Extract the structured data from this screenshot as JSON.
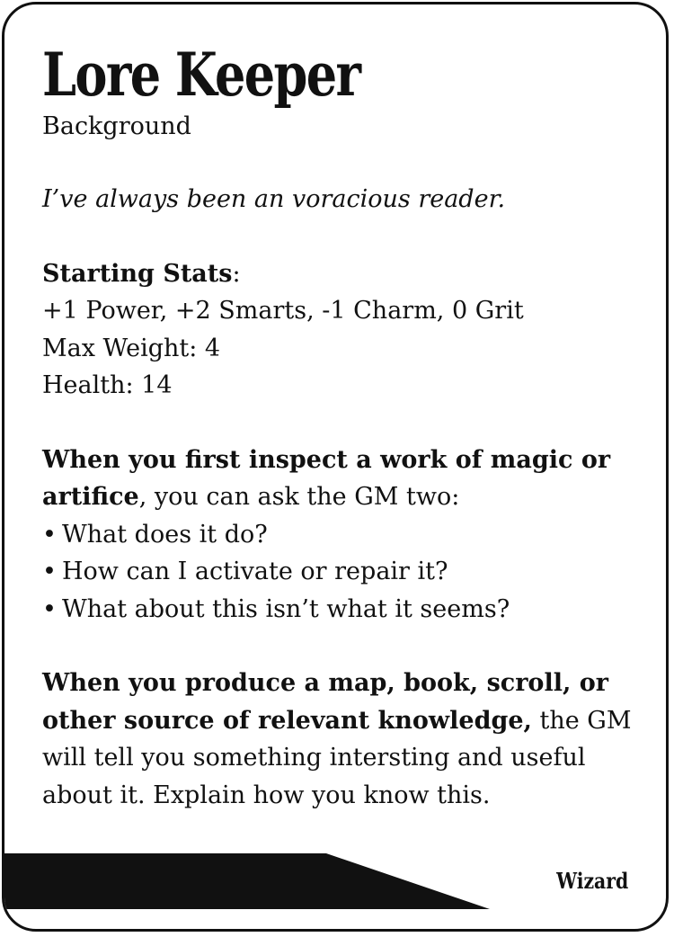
{
  "card": {
    "title": "Lore Keeper",
    "subtitle": "Background",
    "quote": "I’ve always been an voracious reader.",
    "stats": {
      "heading": "Starting Stats",
      "colon": ":",
      "line1": "+1 Power, +2 Smarts, -1 Charm, 0 Grit",
      "line2": "Max Weight: 4",
      "line3": "Health: 14"
    },
    "move1": {
      "bold": "When you first inspect a work of magic or artifice",
      "rest": ", you can ask the GM two:",
      "bullets": [
        "What does it do?",
        "How can I activate or repair it?",
        "What about this isn’t what it seems?"
      ]
    },
    "move2": {
      "bold": "When you produce a map, book, scroll, or other source of relevant knowledge,",
      "rest": " the GM will tell you something intersting and useful about it. Explain how you know this."
    },
    "class_label": "Wizard",
    "bullet_char": "•"
  },
  "colors": {
    "ink": "#111111",
    "background": "#ffffff"
  }
}
